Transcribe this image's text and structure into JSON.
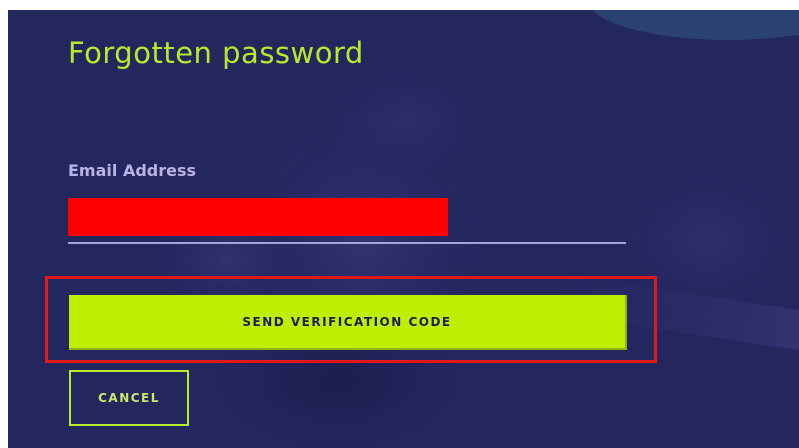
{
  "form": {
    "title": "Forgotten password",
    "email_label": "Email Address",
    "email_value": "",
    "send_button_label": "SEND VERIFICATION CODE",
    "cancel_button_label": "CANCEL"
  },
  "colors": {
    "panel_background": "#24265e",
    "accent": "#b4ec2c",
    "send_button_fill": "#bdf000",
    "label_text": "#b9b3e4",
    "redaction": "#ff0000",
    "highlight_border": "#e01a1a"
  }
}
